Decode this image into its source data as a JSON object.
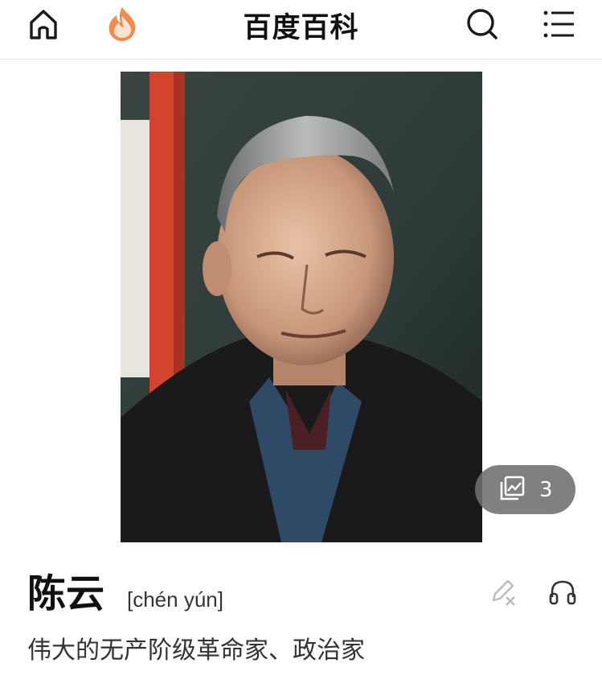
{
  "header": {
    "title": "百度百科",
    "icons": [
      "home-icon",
      "flame-icon",
      "search-icon",
      "menu-icon"
    ],
    "accent_color": "#f58a4b"
  },
  "entry": {
    "gallery_count": "3",
    "name": "陈云",
    "pinyin": "[chén yún]",
    "summary": "伟大的无产阶级革命家、政治家",
    "action_icons": [
      "edit-icon",
      "headphones-icon"
    ]
  }
}
